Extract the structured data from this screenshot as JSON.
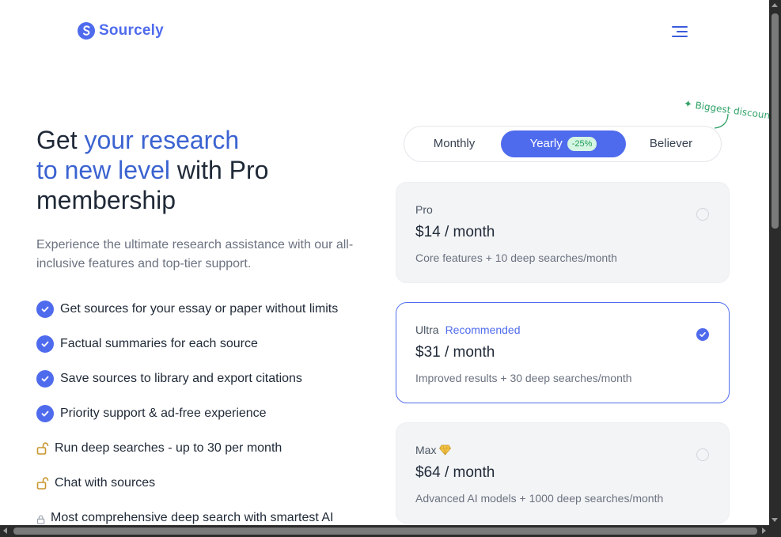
{
  "brand": {
    "name": "Sourcely",
    "color": "#4f6bed"
  },
  "header": {
    "menu_icon": "menu-icon"
  },
  "hero": {
    "title_part1": "Get ",
    "title_highlight1": "your research",
    "title_highlight2": "to new level",
    "title_part2": " with Pro membership",
    "subtitle": "Experience the ultimate research assistance with our all-inclusive features and top-tier support."
  },
  "features": [
    {
      "text": "Get sources for your essay or paper without limits",
      "icon": "check-circle-icon"
    },
    {
      "text": "Factual summaries for each source",
      "icon": "check-circle-icon"
    },
    {
      "text": "Save sources to library and export citations",
      "icon": "check-circle-icon"
    },
    {
      "text": "Priority support & ad-free experience",
      "icon": "check-circle-icon"
    },
    {
      "text": "Run deep searches - up to 30 per month",
      "icon": "unlock-icon"
    },
    {
      "text": "Chat with sources",
      "icon": "unlock-icon"
    },
    {
      "text": "Most comprehensive deep search with smartest AI",
      "icon": "lock-icon"
    }
  ],
  "discount_note": "Biggest discount",
  "billing": {
    "options": [
      "Monthly",
      "Yearly",
      "Believer"
    ],
    "selected": "Yearly",
    "yearly_badge": "-25%"
  },
  "plans": [
    {
      "name": "Pro",
      "tag": "",
      "price": "$14 / month",
      "desc": "Core features + 10 deep searches/month",
      "selected": false
    },
    {
      "name": "Ultra",
      "tag": "Recommended",
      "price": "$31 / month",
      "desc": "Improved results + 30 deep searches/month",
      "selected": true
    },
    {
      "name": "Max",
      "tag": "",
      "icon": "diamond-icon",
      "price": "$64 / month",
      "desc": "Advanced AI models + 1000 deep searches/month",
      "selected": false
    }
  ]
}
